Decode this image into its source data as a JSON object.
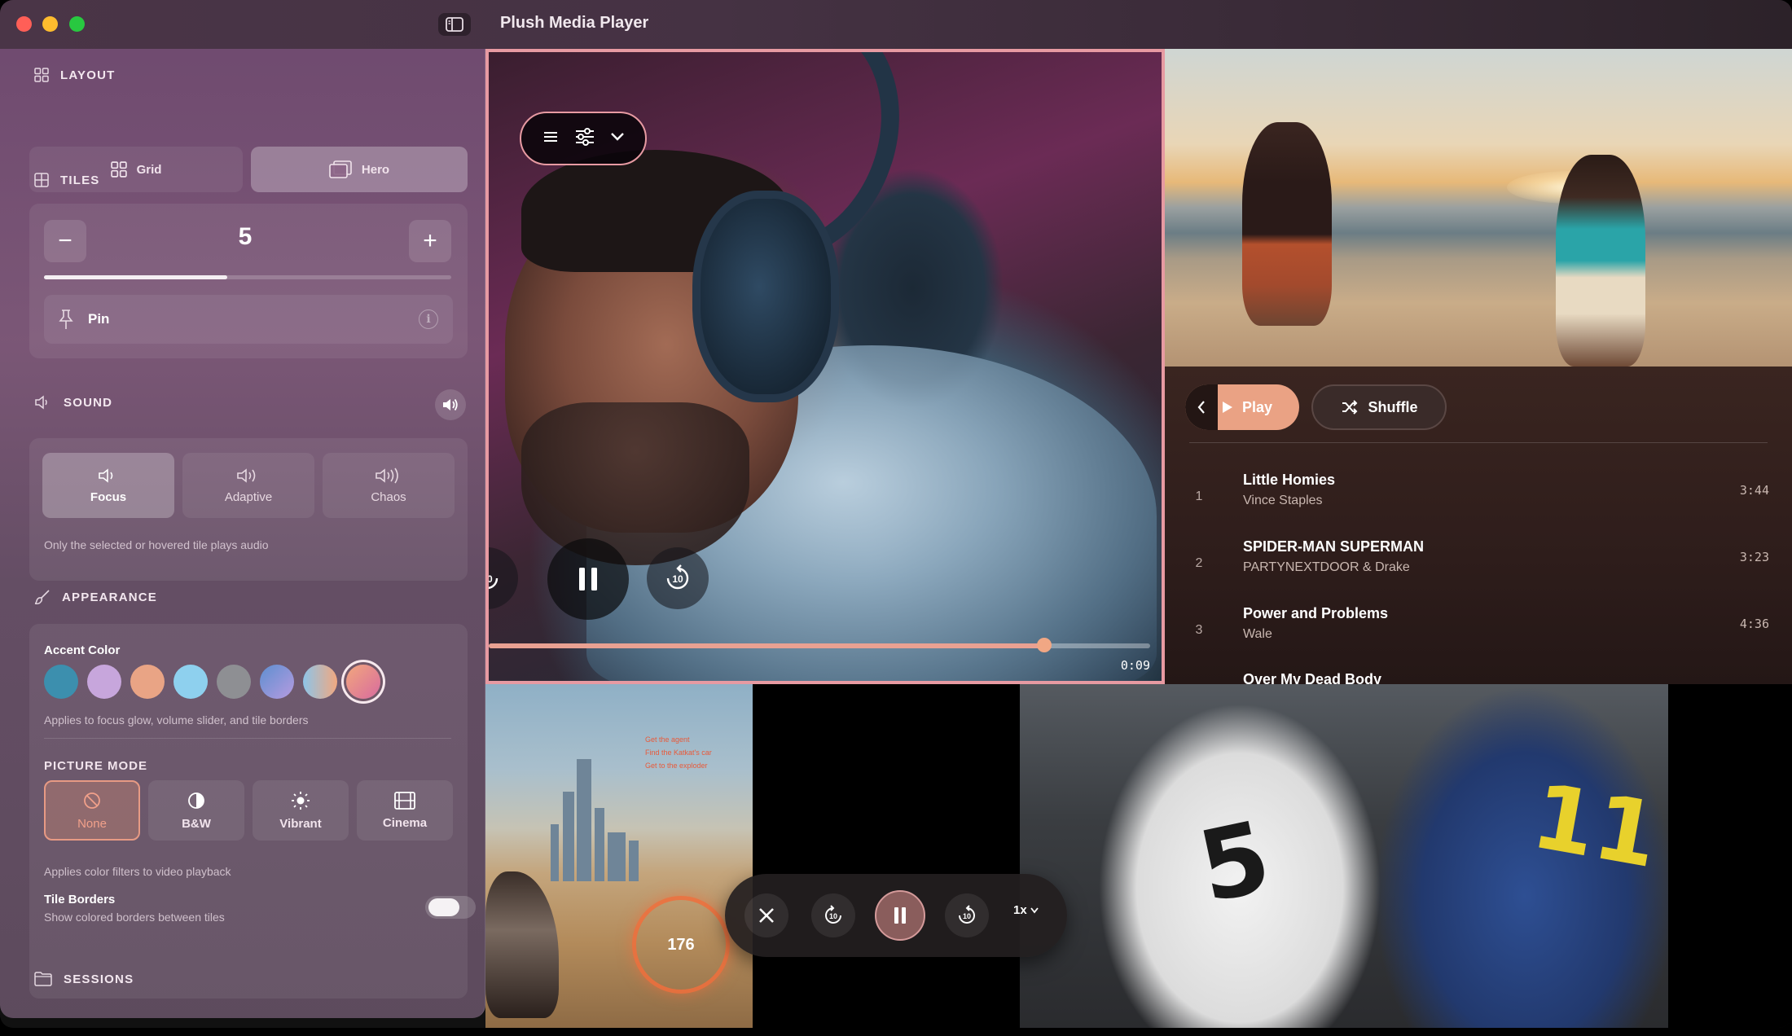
{
  "window": {
    "title": "Plush Media Player"
  },
  "sidebar": {
    "layout": {
      "heading": "LAYOUT",
      "options": [
        "Grid",
        "Hero"
      ],
      "selected": "Hero"
    },
    "tiles": {
      "heading": "TILES",
      "count": "5",
      "decrement_label": "−",
      "increment_label": "+",
      "slider_fraction": 0.45,
      "pin_label": "Pin",
      "info_glyph": "i"
    },
    "sound": {
      "heading": "SOUND",
      "options": [
        "Focus",
        "Adaptive",
        "Chaos"
      ],
      "selected": "Focus",
      "hint": "Only the selected or hovered tile plays audio"
    },
    "appearance": {
      "heading": "APPEARANCE",
      "accent_label": "Accent Color",
      "accent_colors": [
        "#3c8fae",
        "#c7a6dc",
        "#e9a485",
        "#8ed0ee",
        "#8e8f93",
        "gradient-blue-purple",
        "gradient-blue-peach",
        "gradient-peach-pink"
      ],
      "accent_selected_index": 7,
      "accent_hint": "Applies to focus glow, volume slider, and tile borders",
      "picture_mode_heading": "PICTURE MODE",
      "picture_modes": [
        "None",
        "B&W",
        "Vibrant",
        "Cinema"
      ],
      "picture_mode_selected": "None",
      "picture_hint": "Applies color filters to video playback",
      "tile_borders_title": "Tile Borders",
      "tile_borders_sub": "Show colored borders between tiles",
      "tile_borders_on": false
    },
    "sessions": {
      "heading": "SESSIONS"
    }
  },
  "hero_player": {
    "current_time": "0:09",
    "progress_fraction": 0.84,
    "skip_seconds": "10",
    "border_color": "#e79aa2"
  },
  "playlist": {
    "play_label": "Play",
    "shuffle_label": "Shuffle",
    "tracks": [
      {
        "num": "1",
        "title": "Little Homies",
        "artist": "Vince Staples",
        "duration": "3:44"
      },
      {
        "num": "2",
        "title": "SPIDER-MAN SUPERMAN",
        "artist": "PARTYNEXTDOOR & Drake",
        "duration": "3:23"
      },
      {
        "num": "3",
        "title": "Power and Problems",
        "artist": "Wale",
        "duration": "4:36"
      },
      {
        "num": "",
        "title": "Over My Dead Body",
        "artist": "",
        "duration": ""
      }
    ]
  },
  "game_tile": {
    "speed": "176",
    "hud_lines": [
      "Get the agent",
      "Find the Katkat's car",
      "Get to the exploder"
    ]
  },
  "hockey_tile": {
    "jersey_left": "5",
    "jersey_right": "11"
  },
  "mini_controls": {
    "skip_seconds": "10",
    "speed_label": "1x"
  }
}
